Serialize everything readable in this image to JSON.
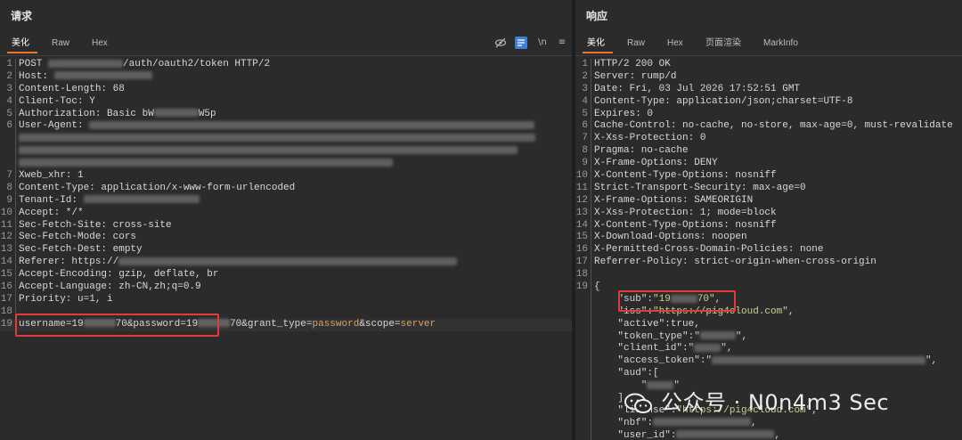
{
  "request": {
    "title": "请求",
    "tabs": [
      "美化",
      "Raw",
      "Hex"
    ],
    "active_tab": 0,
    "toolbar": {
      "wrap_glyph": "\\n",
      "menu_glyph": "≡"
    },
    "lines": [
      {
        "n": "1",
        "parts": [
          [
            "POST ",
            ""
          ],
          [
            "#blur84",
            ""
          ],
          [
            "/auth/oauth2/token HTTP/2",
            ""
          ]
        ]
      },
      {
        "n": "2",
        "parts": [
          [
            "Host: ",
            ""
          ],
          [
            "#blur110",
            ""
          ]
        ]
      },
      {
        "n": "3",
        "parts": [
          [
            "Content-Length: 68",
            ""
          ]
        ]
      },
      {
        "n": "4",
        "parts": [
          [
            "Client-Toc: Y",
            ""
          ]
        ]
      },
      {
        "n": "5",
        "parts": [
          [
            "Authorization: Basic bW",
            ""
          ],
          [
            "#blur50",
            ""
          ],
          [
            "W5p",
            ""
          ]
        ]
      },
      {
        "n": "6",
        "parts": [
          [
            "User-Agent: ",
            ""
          ],
          [
            "#blur500",
            ""
          ]
        ]
      },
      {
        "n": "",
        "parts": [
          [
            "#blur580",
            ""
          ]
        ]
      },
      {
        "n": "",
        "parts": [
          [
            "#blur560",
            ""
          ]
        ]
      },
      {
        "n": "",
        "parts": [
          [
            "#blur420",
            ""
          ]
        ]
      },
      {
        "n": "7",
        "parts": [
          [
            "Xweb_xhr: 1",
            ""
          ]
        ]
      },
      {
        "n": "8",
        "parts": [
          [
            "Content-Type: application/x-www-form-urlencoded",
            ""
          ]
        ]
      },
      {
        "n": "9",
        "parts": [
          [
            "Tenant-Id: ",
            ""
          ],
          [
            "#blur130",
            ""
          ]
        ]
      },
      {
        "n": "10",
        "parts": [
          [
            "Accept: */*",
            ""
          ]
        ]
      },
      {
        "n": "11",
        "parts": [
          [
            "Sec-Fetch-Site: cross-site",
            ""
          ]
        ]
      },
      {
        "n": "12",
        "parts": [
          [
            "Sec-Fetch-Mode: cors",
            ""
          ]
        ]
      },
      {
        "n": "13",
        "parts": [
          [
            "Sec-Fetch-Dest: empty",
            ""
          ]
        ]
      },
      {
        "n": "14",
        "parts": [
          [
            "Referer: https://",
            ""
          ],
          [
            "#blur380",
            ""
          ]
        ]
      },
      {
        "n": "15",
        "parts": [
          [
            "Accept-Encoding: gzip, deflate, br",
            ""
          ]
        ]
      },
      {
        "n": "16",
        "parts": [
          [
            "Accept-Language: zh-CN,zh;q=0.9",
            ""
          ]
        ]
      },
      {
        "n": "17",
        "parts": [
          [
            "Priority: u=1, i",
            ""
          ]
        ]
      },
      {
        "n": "18",
        "parts": [
          [
            "",
            ""
          ]
        ]
      },
      {
        "n": "19",
        "hl": true,
        "parts": [
          [
            "username",
            ""
          ],
          [
            "=",
            ""
          ],
          [
            "19",
            ""
          ],
          [
            "#blur36",
            ""
          ],
          [
            "70",
            ""
          ],
          [
            "&password",
            ""
          ],
          [
            "=",
            ""
          ],
          [
            "19",
            ""
          ],
          [
            "#blur36",
            ""
          ],
          [
            "70",
            ""
          ],
          [
            "&grant_type",
            ""
          ],
          [
            "=",
            ""
          ],
          [
            "password",
            "orange"
          ],
          [
            "&scope",
            ""
          ],
          [
            "=",
            ""
          ],
          [
            "server",
            "orange"
          ]
        ]
      }
    ]
  },
  "response": {
    "title": "响应",
    "tabs": [
      "美化",
      "Raw",
      "Hex",
      "页面渲染",
      "MarkInfo"
    ],
    "active_tab": 0,
    "lines": [
      {
        "n": "1",
        "parts": [
          [
            "HTTP/2 200 OK",
            ""
          ]
        ]
      },
      {
        "n": "2",
        "parts": [
          [
            "Server: rump/d",
            ""
          ]
        ]
      },
      {
        "n": "3",
        "parts": [
          [
            "Date: Fri, 03 Jul 2026 17:52:51 GMT",
            ""
          ]
        ]
      },
      {
        "n": "4",
        "parts": [
          [
            "Content-Type: application/json;charset=UTF-8",
            ""
          ]
        ]
      },
      {
        "n": "5",
        "parts": [
          [
            "Expires: 0",
            ""
          ]
        ]
      },
      {
        "n": "6",
        "parts": [
          [
            "Cache-Control: no-cache, no-store, max-age=0, must-revalidate",
            ""
          ]
        ]
      },
      {
        "n": "7",
        "parts": [
          [
            "X-Xss-Protection: 0",
            ""
          ]
        ]
      },
      {
        "n": "8",
        "parts": [
          [
            "Pragma: no-cache",
            ""
          ]
        ]
      },
      {
        "n": "9",
        "parts": [
          [
            "X-Frame-Options: DENY",
            ""
          ]
        ]
      },
      {
        "n": "10",
        "parts": [
          [
            "X-Content-Type-Options: nosniff",
            ""
          ]
        ]
      },
      {
        "n": "11",
        "parts": [
          [
            "Strict-Transport-Security: max-age=0",
            ""
          ]
        ]
      },
      {
        "n": "12",
        "parts": [
          [
            "X-Frame-Options: SAMEORIGIN",
            ""
          ]
        ]
      },
      {
        "n": "13",
        "parts": [
          [
            "X-Xss-Protection: 1; mode=block",
            ""
          ]
        ]
      },
      {
        "n": "14",
        "parts": [
          [
            "X-Content-Type-Options: nosniff",
            ""
          ]
        ]
      },
      {
        "n": "15",
        "parts": [
          [
            "X-Download-Options: noopen",
            ""
          ]
        ]
      },
      {
        "n": "16",
        "parts": [
          [
            "X-Permitted-Cross-Domain-Policies: none",
            ""
          ]
        ]
      },
      {
        "n": "17",
        "parts": [
          [
            "Referrer-Policy: strict-origin-when-cross-origin",
            ""
          ]
        ]
      },
      {
        "n": "18",
        "parts": [
          [
            "",
            ""
          ]
        ]
      },
      {
        "n": "19",
        "parts": [
          [
            "{",
            ""
          ]
        ]
      },
      {
        "n": "",
        "parts": [
          [
            "    \"sub\":",
            "key"
          ],
          [
            "\"19",
            "str"
          ],
          [
            "#blur30",
            ""
          ],
          [
            "70\"",
            "str"
          ],
          [
            ",",
            ""
          ]
        ]
      },
      {
        "n": "",
        "parts": [
          [
            "    \"iss\":",
            "key"
          ],
          [
            "\"https://pig4cloud.com\"",
            "str"
          ],
          [
            ",",
            ""
          ]
        ]
      },
      {
        "n": "",
        "parts": [
          [
            "    \"active\":",
            "key"
          ],
          [
            "true",
            ""
          ],
          [
            ",",
            ""
          ]
        ]
      },
      {
        "n": "",
        "parts": [
          [
            "    \"token_type\":",
            "key"
          ],
          [
            "\"",
            "str"
          ],
          [
            "#blur40",
            ""
          ],
          [
            "\"",
            "str"
          ],
          [
            ",",
            ""
          ]
        ]
      },
      {
        "n": "",
        "parts": [
          [
            "    \"client_id\":",
            "key"
          ],
          [
            "\"",
            "str"
          ],
          [
            "#blur30",
            ""
          ],
          [
            "\"",
            "str"
          ],
          [
            ",",
            ""
          ]
        ]
      },
      {
        "n": "",
        "parts": [
          [
            "    \"access_token\":",
            "key"
          ],
          [
            "\"",
            "str"
          ],
          [
            "#blur240",
            ""
          ],
          [
            "\"",
            "str"
          ],
          [
            ",",
            ""
          ]
        ]
      },
      {
        "n": "",
        "parts": [
          [
            "    \"aud\":[",
            "key"
          ]
        ]
      },
      {
        "n": "",
        "parts": [
          [
            "        \"",
            "str"
          ],
          [
            "#blur30",
            ""
          ],
          [
            "\"",
            "str"
          ]
        ]
      },
      {
        "n": "",
        "parts": [
          [
            "    ],",
            ""
          ]
        ]
      },
      {
        "n": "",
        "parts": [
          [
            "    \"license\":",
            "key"
          ],
          [
            "\"https://pig4cloud.com\"",
            "str"
          ],
          [
            ",",
            ""
          ]
        ]
      },
      {
        "n": "",
        "parts": [
          [
            "    \"nbf\":",
            "key"
          ],
          [
            "#blur110",
            ""
          ],
          [
            ",",
            ""
          ]
        ]
      },
      {
        "n": "",
        "parts": [
          [
            "    \"user_id\":",
            "key"
          ],
          [
            "#blur110",
            ""
          ],
          [
            ",",
            ""
          ]
        ]
      }
    ]
  },
  "watermark": {
    "text": "公众号 · N0n4m3 Sec",
    "icon": "wechat-icon"
  },
  "colors": {
    "accent": "#e8762c",
    "highlight_box": "#e23b3b",
    "string": "#c6d58f",
    "value": "#d6a26a"
  }
}
